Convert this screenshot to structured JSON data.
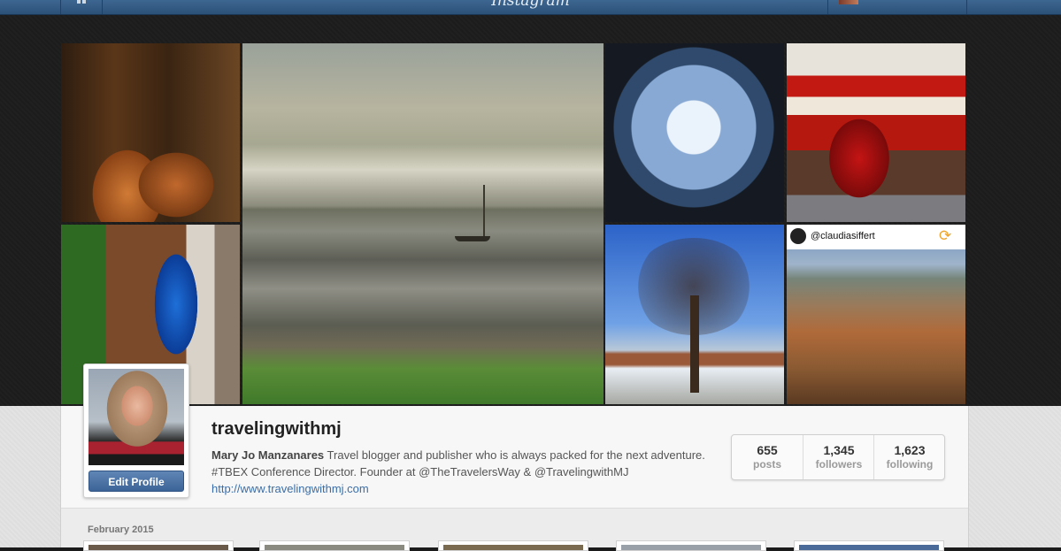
{
  "topbar": {
    "logo_text": "Instagram"
  },
  "grid": {
    "promo_tile": {
      "handle": "@claudiasiffert"
    }
  },
  "profile": {
    "username": "travelingwithmj",
    "full_name": "Mary Jo Manzanares",
    "bio_text": " Travel blogger and publisher who is always packed for the next adventure. #TBEX Conference Director. Founder at @TheTravelersWay & @TravelingwithMJ ",
    "website": "http://www.travelingwithmj.com",
    "edit_profile_label": "Edit Profile",
    "stats": [
      {
        "value": "655",
        "label": "posts"
      },
      {
        "value": "1,345",
        "label": "followers"
      },
      {
        "value": "1,623",
        "label": "following"
      }
    ]
  },
  "feed": {
    "month_label": "February 2015"
  },
  "colors": {
    "topbar": "#2b5178",
    "link": "#3b6ea8",
    "button": "#3d6497"
  }
}
